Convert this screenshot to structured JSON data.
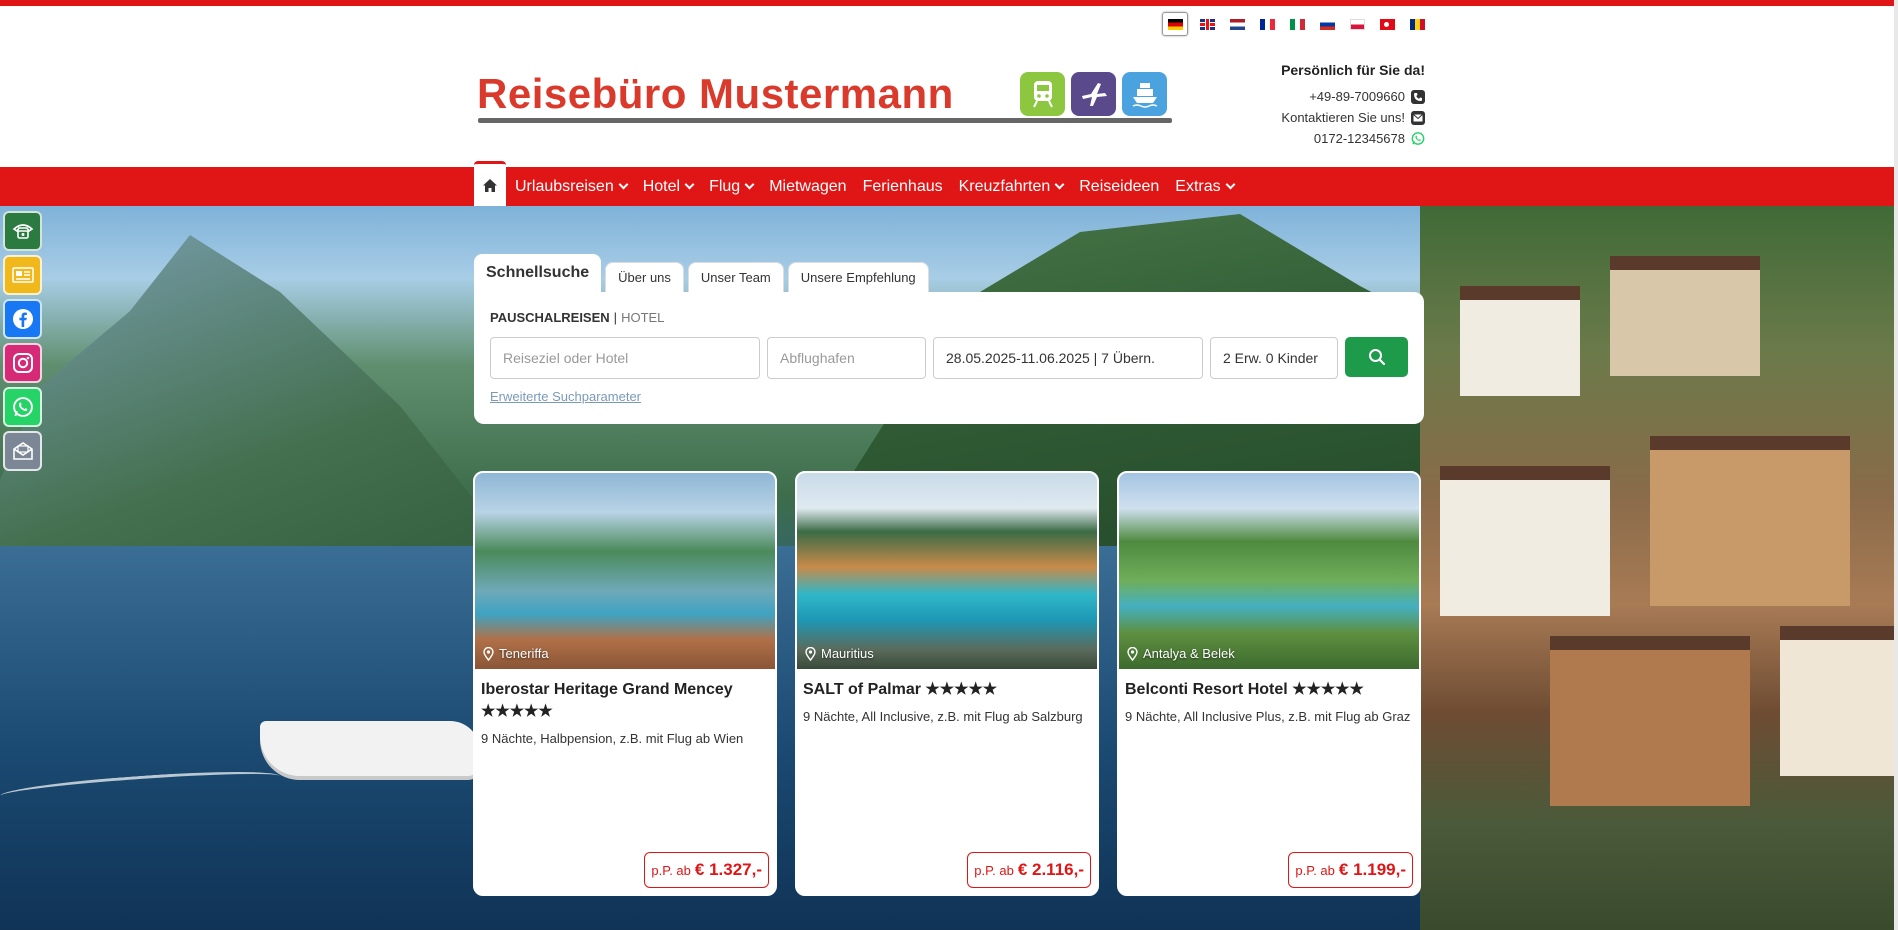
{
  "languages": [
    {
      "code": "de",
      "active": true
    },
    {
      "code": "gb",
      "active": false
    },
    {
      "code": "nl",
      "active": false
    },
    {
      "code": "fr",
      "active": false
    },
    {
      "code": "it",
      "active": false
    },
    {
      "code": "ru",
      "active": false
    },
    {
      "code": "pl",
      "active": false
    },
    {
      "code": "tr",
      "active": false
    },
    {
      "code": "ro",
      "active": false
    }
  ],
  "brand": {
    "name": "Reisebüro Mustermann",
    "color": "#d93a2b",
    "travel_icons": [
      "train-icon",
      "plane-icon",
      "ship-icon"
    ]
  },
  "contact": {
    "title": "Persönlich für Sie da!",
    "phone": "+49-89-7009660",
    "email_label": "Kontaktieren Sie uns!",
    "whatsapp": "0172-12345678"
  },
  "nav": {
    "accent": "#e01515",
    "items": [
      {
        "label": "Urlaubsreisen",
        "dropdown": true
      },
      {
        "label": "Hotel",
        "dropdown": true
      },
      {
        "label": "Flug",
        "dropdown": true
      },
      {
        "label": "Mietwagen",
        "dropdown": false
      },
      {
        "label": "Ferienhaus",
        "dropdown": false
      },
      {
        "label": "Kreuzfahrten",
        "dropdown": true
      },
      {
        "label": "Reiseideen",
        "dropdown": false
      },
      {
        "label": "Extras",
        "dropdown": true
      }
    ]
  },
  "side_bar": [
    "phone-icon",
    "newsletter-icon",
    "facebook-icon",
    "instagram-icon",
    "whatsapp-icon",
    "mail-icon"
  ],
  "search": {
    "tabs": [
      "Schnellsuche",
      "Über uns",
      "Unser Team",
      "Unsere Empfehlung"
    ],
    "active_tab": "Schnellsuche",
    "type_active": "PAUSCHALREISEN",
    "type_separator": "|",
    "type_other": "HOTEL",
    "destination_placeholder": "Reiseziel oder Hotel",
    "airport_placeholder": "Abflughafen",
    "dates_value": "28.05.2025-11.06.2025 | 7 Übern.",
    "travellers_value": "2 Erw. 0 Kinder",
    "advanced_link": "Erweiterte Suchparameter",
    "button_color": "#1d9a4a"
  },
  "offers": [
    {
      "location": "Teneriffa",
      "hotel": "Iberostar Heritage Grand Mencey",
      "stars": "★★★★★",
      "stars_count": 5,
      "details": "9 Nächte, Halbpension, z.B. mit Flug ab Wien",
      "price_prefix": "p.P. ab",
      "price": "€ 1.327,-"
    },
    {
      "location": "Mauritius",
      "hotel": "SALT of Palmar",
      "stars": "★★★★★",
      "stars_count": 5,
      "details": "9 Nächte, All Inclusive, z.B. mit Flug ab Salzburg",
      "price_prefix": "p.P. ab",
      "price": "€ 2.116,-"
    },
    {
      "location": "Antalya & Belek",
      "hotel": "Belconti Resort Hotel",
      "stars": "★★★★★",
      "stars_count": 5,
      "details": "9 Nächte, All Inclusive Plus, z.B. mit Flug ab Graz",
      "price_prefix": "p.P. ab",
      "price": "€ 1.199,-"
    }
  ]
}
